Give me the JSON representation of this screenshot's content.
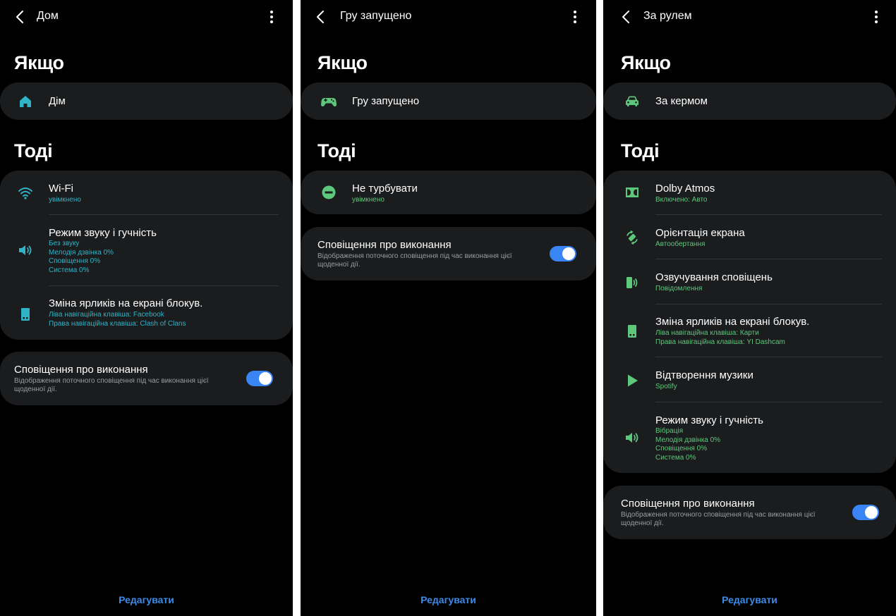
{
  "common": {
    "if_heading": "Якщо",
    "then_heading": "Тоді",
    "notif_title": "Сповіщення про виконання",
    "notif_desc": "Відображення поточного сповіщення під час виконання цієї щоденної дії.",
    "edit_label": "Редагувати",
    "toggle_on": true,
    "toggle_color": "#3a85f4"
  },
  "screens": [
    {
      "title": "Дом",
      "accent": "#30b3c6",
      "condition": {
        "icon": "home-icon",
        "label": "Дім"
      },
      "actions": [
        {
          "icon": "wifi-icon",
          "title": "Wi-Fi",
          "sub": [
            "увімкнено"
          ]
        },
        {
          "icon": "volume-icon",
          "title": "Режим звуку і гучність",
          "sub": [
            "Без звуку",
            "Мелодія дзвінка 0%",
            "Сповіщення 0%",
            "Система 0%"
          ]
        },
        {
          "icon": "lockscreen-phone-icon",
          "title": "Зміна ярликів на екрані блокув.",
          "sub": [
            "Ліва навігаційна клавіша: Facebook",
            "Права навігаційна клавіша: Clash of Clans"
          ]
        }
      ]
    },
    {
      "title": "Гру запущено",
      "accent": "#5dc77c",
      "condition": {
        "icon": "gamepad-icon",
        "label": "Гру запущено"
      },
      "actions": [
        {
          "icon": "do-not-disturb-icon",
          "title": "Не турбувати",
          "sub": [
            "увімкнено"
          ]
        }
      ]
    },
    {
      "title": "За рулем",
      "accent": "#5dc77c",
      "condition": {
        "icon": "car-icon",
        "label": "За кермом"
      },
      "actions": [
        {
          "icon": "dolby-icon",
          "title": "Dolby Atmos",
          "sub": [
            "Включено: Авто"
          ]
        },
        {
          "icon": "rotate-screen-icon",
          "title": "Орієнтація екрана",
          "sub": [
            "Автообертання"
          ]
        },
        {
          "icon": "read-aloud-icon",
          "title": "Озвучування сповіщень",
          "sub": [
            "Повідомлення"
          ]
        },
        {
          "icon": "lockscreen-phone-icon",
          "title": "Зміна ярликів на екрані блокув.",
          "sub": [
            "Ліва навігаційна клавіша: Карти",
            "Права навігаційна клавіша: YI Dashcam"
          ]
        },
        {
          "icon": "play-icon",
          "title": "Відтворення музики",
          "sub": [
            "Spotify"
          ]
        },
        {
          "icon": "volume-icon",
          "title": "Режим звуку і гучність",
          "sub": [
            "Вібрація",
            "Мелодія дзвінка 0%",
            "Сповіщення 0%",
            "Система 0%"
          ]
        }
      ]
    }
  ]
}
